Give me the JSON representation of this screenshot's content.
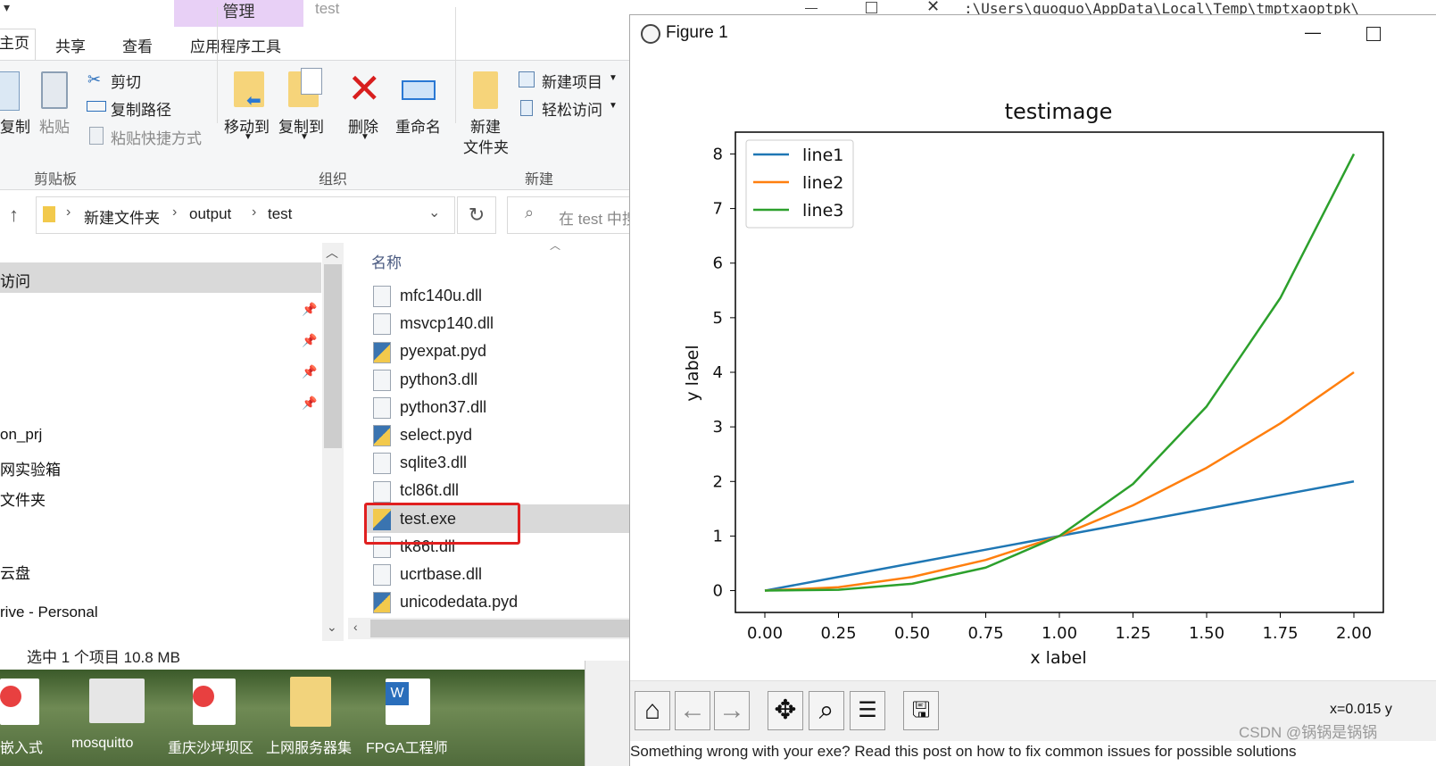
{
  "explorer": {
    "context_tab": "管理",
    "window_title": "test",
    "tabs": [
      "主页",
      "共享",
      "查看",
      "应用程序工具"
    ],
    "ribbon": {
      "clipboard": {
        "copy": "复制",
        "paste": "粘贴",
        "cut": "剪切",
        "copy_path": "复制路径",
        "paste_shortcut": "粘贴快捷方式",
        "group": "剪贴板"
      },
      "organize": {
        "move_to": "移动到",
        "copy_to": "复制到",
        "delete": "删除",
        "rename": "重命名",
        "group": "组织"
      },
      "new": {
        "new_folder_1": "新建",
        "new_folder_2": "文件夹",
        "new_item": "新建项目",
        "easy_access": "轻松访问",
        "group": "新建"
      }
    },
    "breadcrumb": [
      "新建文件夹",
      "output",
      "test"
    ],
    "search_placeholder": "在 test 中搜",
    "nav_items": [
      "访问",
      "on_prj",
      "网实验箱",
      "文件夹",
      "云盘",
      "rive - Personal"
    ],
    "column_header": "名称",
    "files": [
      {
        "name": "mfc140u.dll",
        "icon": "dll-icon"
      },
      {
        "name": "msvcp140.dll",
        "icon": "dll-icon"
      },
      {
        "name": "pyexpat.pyd",
        "icon": "python-icon"
      },
      {
        "name": "python3.dll",
        "icon": "dll-icon"
      },
      {
        "name": "python37.dll",
        "icon": "dll-icon"
      },
      {
        "name": "select.pyd",
        "icon": "python-icon"
      },
      {
        "name": "sqlite3.dll",
        "icon": "dll-icon"
      },
      {
        "name": "tcl86t.dll",
        "icon": "dll-icon"
      },
      {
        "name": "test.exe",
        "icon": "exe-icon",
        "selected": true
      },
      {
        "name": "tk86t.dll",
        "icon": "dll-icon"
      },
      {
        "name": "ucrtbase.dll",
        "icon": "dll-icon"
      },
      {
        "name": "unicodedata.pyd",
        "icon": "python-icon"
      }
    ],
    "status": "选中 1 个项目  10.8 MB"
  },
  "desktop": {
    "labels": [
      "嵌入式",
      "mosquitto",
      "重庆沙坪坝区",
      "上网服务器集",
      "FPGA工程师"
    ]
  },
  "background_terminal": {
    "path": ":\\Users\\guoguo\\AppData\\Local\\Temp\\tmptxaoptpk\\"
  },
  "figure": {
    "window_title": "Figure 1",
    "coord_readout": "x=0.015 y",
    "watermark": "CSDN @锅锅是锅锅",
    "bottom_text": "Something wrong with your exe? Read this post on how to fix common issues for possible solutions"
  },
  "chart_data": {
    "type": "line",
    "title": "testimage",
    "xlabel": "x label",
    "ylabel": "y label",
    "xlim": [
      -0.1,
      2.1
    ],
    "ylim": [
      -0.4,
      8.4
    ],
    "xticks": [
      "0.00",
      "0.25",
      "0.50",
      "0.75",
      "1.00",
      "1.25",
      "1.50",
      "1.75",
      "2.00"
    ],
    "yticks": [
      "0",
      "1",
      "2",
      "3",
      "4",
      "5",
      "6",
      "7",
      "8"
    ],
    "legend_position": "top-left",
    "x": [
      0.0,
      0.25,
      0.5,
      0.75,
      1.0,
      1.25,
      1.5,
      1.75,
      2.0
    ],
    "series": [
      {
        "name": "line1",
        "color": "#1f77b4",
        "values": [
          0.0,
          0.25,
          0.5,
          0.75,
          1.0,
          1.25,
          1.5,
          1.75,
          2.0
        ]
      },
      {
        "name": "line2",
        "color": "#ff7f0e",
        "values": [
          0.0,
          0.0625,
          0.25,
          0.5625,
          1.0,
          1.5625,
          2.25,
          3.0625,
          4.0
        ]
      },
      {
        "name": "line3",
        "color": "#2ca02c",
        "values": [
          0.0,
          0.015625,
          0.125,
          0.421875,
          1.0,
          1.953125,
          3.375,
          5.359375,
          8.0
        ]
      }
    ]
  }
}
